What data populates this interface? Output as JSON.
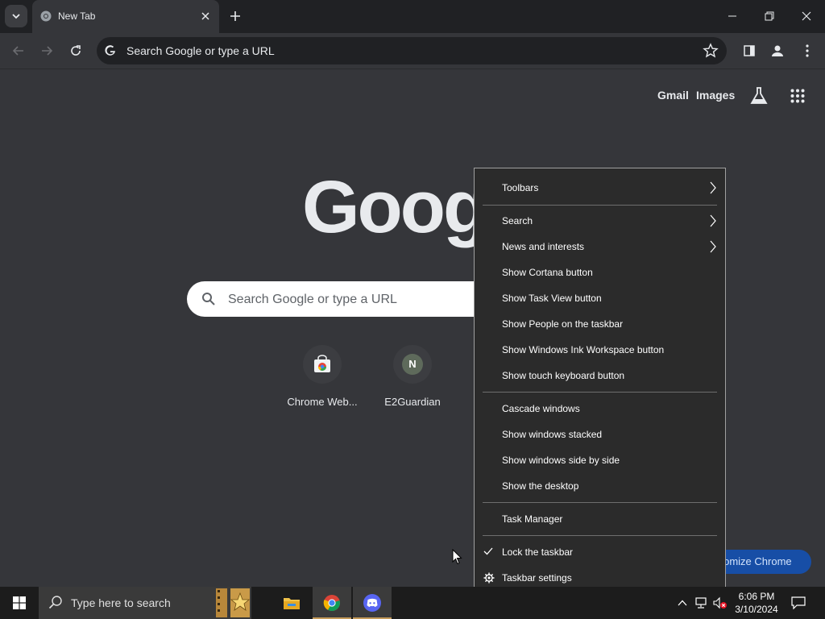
{
  "browser": {
    "tab": {
      "title": "New Tab"
    },
    "omnibox": {
      "placeholder": "Search Google or type a URL"
    },
    "colors": {
      "frame": "#202124",
      "toolbar": "#35363a",
      "text": "#e8eaed"
    }
  },
  "ntp": {
    "links": {
      "gmail": "Gmail",
      "images": "Images"
    },
    "logo_partial": "Goog",
    "search_placeholder": "Search Google or type a URL",
    "shortcuts": [
      {
        "label": "Chrome Web...",
        "icon": "chrome-web-store-icon"
      },
      {
        "label": "E2Guardian",
        "letter": "N",
        "icon": "letter-avatar-icon"
      }
    ],
    "customize_label": "stomize Chrome"
  },
  "context_menu": {
    "items": [
      {
        "label": "Toolbars",
        "submenu": true
      },
      {
        "label": "Search",
        "submenu": true
      },
      {
        "label": "News and interests",
        "submenu": true
      },
      {
        "label": "Show Cortana button"
      },
      {
        "label": "Show Task View button"
      },
      {
        "label": "Show People on the taskbar"
      },
      {
        "label": "Show Windows Ink Workspace button"
      },
      {
        "label": "Show touch keyboard button"
      },
      {
        "label": "Cascade windows"
      },
      {
        "label": "Show windows stacked"
      },
      {
        "label": "Show windows side by side"
      },
      {
        "label": "Show the desktop"
      },
      {
        "label": "Task Manager"
      },
      {
        "label": "Lock the taskbar",
        "checked": true
      },
      {
        "label": "Taskbar settings",
        "icon": "gear-icon"
      }
    ]
  },
  "taskbar": {
    "search_placeholder": "Type here to search",
    "apps": [
      "file-explorer-icon",
      "chrome-icon",
      "discord-icon"
    ],
    "time": "6:06 PM",
    "date": "3/10/2024"
  }
}
